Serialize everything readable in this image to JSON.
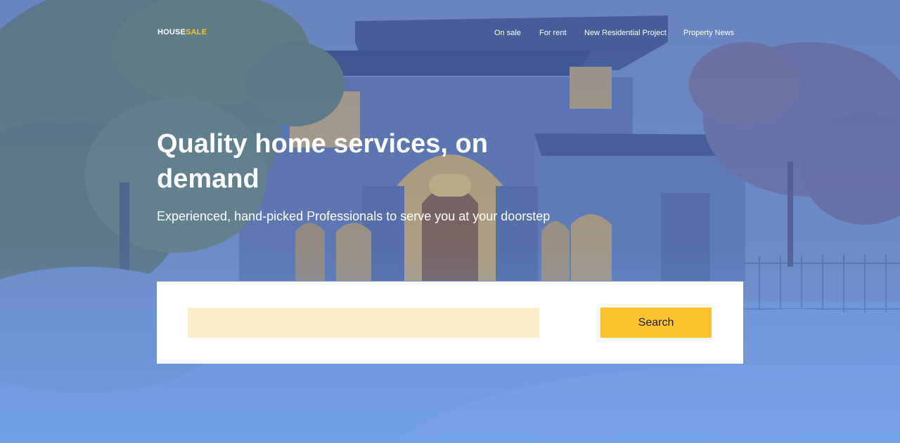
{
  "header": {
    "logo_part1": "HOUSE",
    "logo_part2": "SALE",
    "nav": [
      {
        "label": "On sale"
      },
      {
        "label": "For rent"
      },
      {
        "label": "New Residential Project"
      },
      {
        "label": "Property News"
      }
    ]
  },
  "hero": {
    "title": "Quality home services, on demand",
    "subtitle": "Experienced, hand-picked Professionals to serve you at your doorstep",
    "background_image": "house-photo"
  },
  "search": {
    "value": "",
    "placeholder": "",
    "button_label": "Search"
  },
  "colors": {
    "accent": "#fbc42e",
    "input_background": "#feeec6",
    "overlay": "#6f97df"
  }
}
